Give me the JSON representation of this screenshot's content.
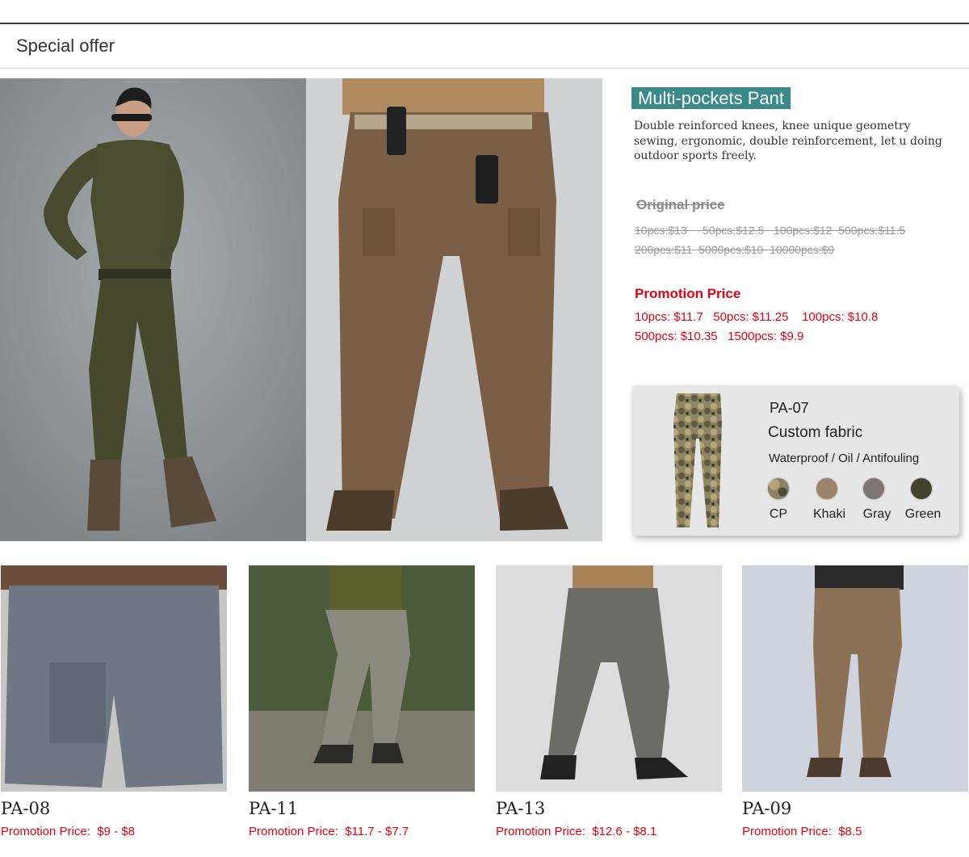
{
  "header": {
    "title": "Special offer"
  },
  "featured": {
    "title": "Multi-pockets Pant",
    "description": "Double reinforced knees, knee unique geometry sewing, ergonomic, double reinforcement, let u doing outdoor sports freely.",
    "original_label": "Original price",
    "original_lines": [
      "10pcs:$13     50pcs:$12.5   100pcs:$12  500pcs:$11.5",
      "200pcs:$11  5000pcs:$10  10000pcs:$9"
    ],
    "promo_label": "Promotion Price",
    "promo_lines": [
      "10pcs: $11.7   50pcs: $11.25    100pcs: $10.8",
      "500pcs: $10.35   1500pcs: $9.9"
    ]
  },
  "card": {
    "code": "PA-07",
    "fabric": "Custom fabric",
    "features": "Waterproof / Oil / Antifouling",
    "colors": [
      {
        "name": "CP",
        "hex": "#8a8466"
      },
      {
        "name": "Khaki",
        "hex": "#9c8466"
      },
      {
        "name": "Gray",
        "hex": "#7e7674"
      },
      {
        "name": "Green",
        "hex": "#45422f"
      }
    ]
  },
  "products": [
    {
      "code": "PA-08",
      "price_label": "Promotion Price:",
      "price": "$9 - $8",
      "color": "#6f7782"
    },
    {
      "code": "PA-11",
      "price_label": "Promotion Price:",
      "price": "$11.7 - $7.7",
      "color": "#8a8a7e"
    },
    {
      "code": "PA-13",
      "price_label": "Promotion Price:",
      "price": "$12.6 - $8.1",
      "color": "#6b6b67"
    },
    {
      "code": "PA-09",
      "price_label": "Promotion Price:",
      "price": "$8.5",
      "color": "#8b7257"
    }
  ]
}
